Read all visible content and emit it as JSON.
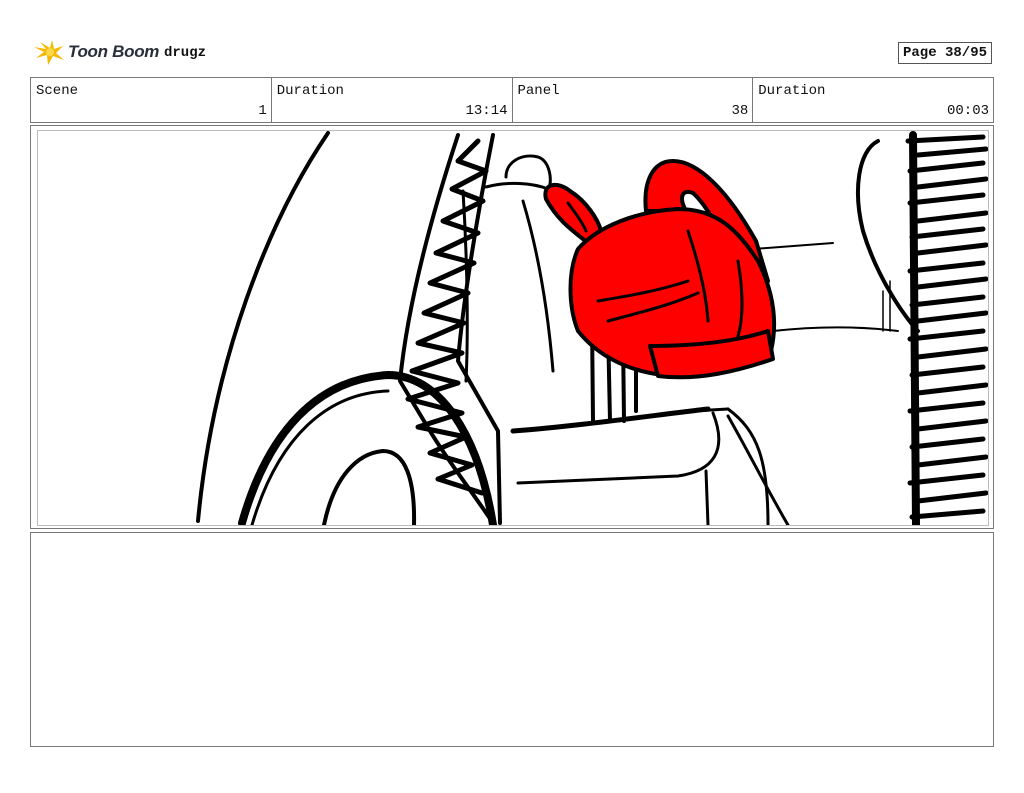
{
  "header": {
    "logo_text": "Toon Boom",
    "project_name": "drugz",
    "page_label": "Page 38/95"
  },
  "info": [
    {
      "label": "Scene",
      "value": "1"
    },
    {
      "label": "Duration",
      "value": "13:14"
    },
    {
      "label": "Panel",
      "value": "38"
    },
    {
      "label": "Duration",
      "value": "00:03"
    }
  ],
  "colors": {
    "logo_accent": "#f5b800",
    "jug_fill": "#ff0000",
    "ink": "#000000"
  },
  "icons": {
    "logo": "toon-boom-star-icon"
  }
}
